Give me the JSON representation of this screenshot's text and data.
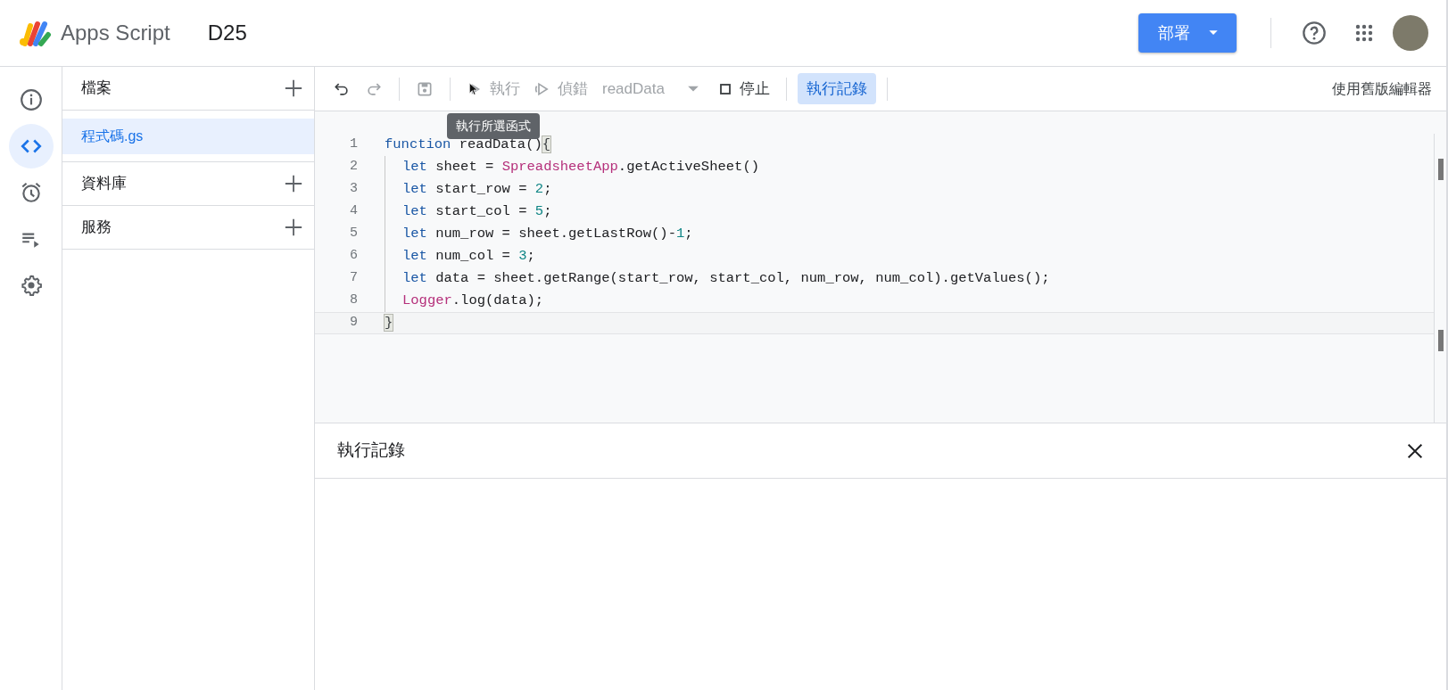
{
  "header": {
    "app_name": "Apps Script",
    "project_title": "D25",
    "deploy_button": "部署"
  },
  "rail": [
    {
      "kind": "info",
      "selected": false
    },
    {
      "kind": "code",
      "selected": true
    },
    {
      "kind": "triggers",
      "selected": false
    },
    {
      "kind": "executions",
      "selected": false
    },
    {
      "kind": "settings",
      "selected": false
    }
  ],
  "files_panel": {
    "sections": [
      {
        "title": "檔案",
        "files": [
          {
            "name": "程式碼.gs",
            "selected": true
          }
        ]
      },
      {
        "title": "資料庫"
      },
      {
        "title": "服務"
      }
    ]
  },
  "toolbar": {
    "undo_disabled": false,
    "redo_disabled": true,
    "save_disabled": true,
    "run": {
      "label": "執行",
      "disabled": true
    },
    "debug": {
      "label": "偵錯",
      "disabled": true
    },
    "function_select": {
      "value": "readData",
      "disabled": true
    },
    "stop": {
      "label": "停止",
      "disabled": false
    },
    "log_toggle": {
      "label": "執行記錄",
      "selected": true
    },
    "legacy_editor": "使用舊版編輯器",
    "tooltip": "執行所選函式"
  },
  "code": {
    "lines": [
      {
        "number": "1",
        "indented": false,
        "current": false,
        "tokens": [
          {
            "kind": "keyword",
            "text": "function"
          },
          {
            "kind": "plain",
            "text": " readData()"
          },
          {
            "kind": "bracket-match",
            "text": "{"
          }
        ]
      },
      {
        "number": "2",
        "indented": true,
        "current": false,
        "tokens": [
          {
            "kind": "keyword",
            "text": "let"
          },
          {
            "kind": "plain",
            "text": " sheet = "
          },
          {
            "kind": "class",
            "text": "SpreadsheetApp"
          },
          {
            "kind": "plain",
            "text": ".getActiveSheet()"
          }
        ]
      },
      {
        "number": "3",
        "indented": true,
        "current": false,
        "tokens": [
          {
            "kind": "keyword",
            "text": "let"
          },
          {
            "kind": "plain",
            "text": " start_row = "
          },
          {
            "kind": "number",
            "text": "2"
          },
          {
            "kind": "plain",
            "text": ";"
          }
        ]
      },
      {
        "number": "4",
        "indented": true,
        "current": false,
        "tokens": [
          {
            "kind": "keyword",
            "text": "let"
          },
          {
            "kind": "plain",
            "text": " start_col = "
          },
          {
            "kind": "number",
            "text": "5"
          },
          {
            "kind": "plain",
            "text": ";"
          }
        ]
      },
      {
        "number": "5",
        "indented": true,
        "current": false,
        "tokens": [
          {
            "kind": "keyword",
            "text": "let"
          },
          {
            "kind": "plain",
            "text": " num_row = sheet.getLastRow()-"
          },
          {
            "kind": "number",
            "text": "1"
          },
          {
            "kind": "plain",
            "text": ";"
          }
        ]
      },
      {
        "number": "6",
        "indented": true,
        "current": false,
        "tokens": [
          {
            "kind": "keyword",
            "text": "let"
          },
          {
            "kind": "plain",
            "text": " num_col = "
          },
          {
            "kind": "number",
            "text": "3"
          },
          {
            "kind": "plain",
            "text": ";"
          }
        ]
      },
      {
        "number": "7",
        "indented": true,
        "current": false,
        "tokens": [
          {
            "kind": "keyword",
            "text": "let"
          },
          {
            "kind": "plain",
            "text": " data = sheet.getRange(start_row, start_col, num_row, num_col).getValues();"
          }
        ]
      },
      {
        "number": "8",
        "indented": true,
        "current": false,
        "tokens": [
          {
            "kind": "class",
            "text": "Logger"
          },
          {
            "kind": "plain",
            "text": ".log(data);"
          }
        ]
      },
      {
        "number": "9",
        "indented": false,
        "current": true,
        "tokens": [
          {
            "kind": "bracket-match",
            "text": "}"
          }
        ]
      }
    ]
  },
  "log_panel": {
    "title": "執行記錄"
  }
}
